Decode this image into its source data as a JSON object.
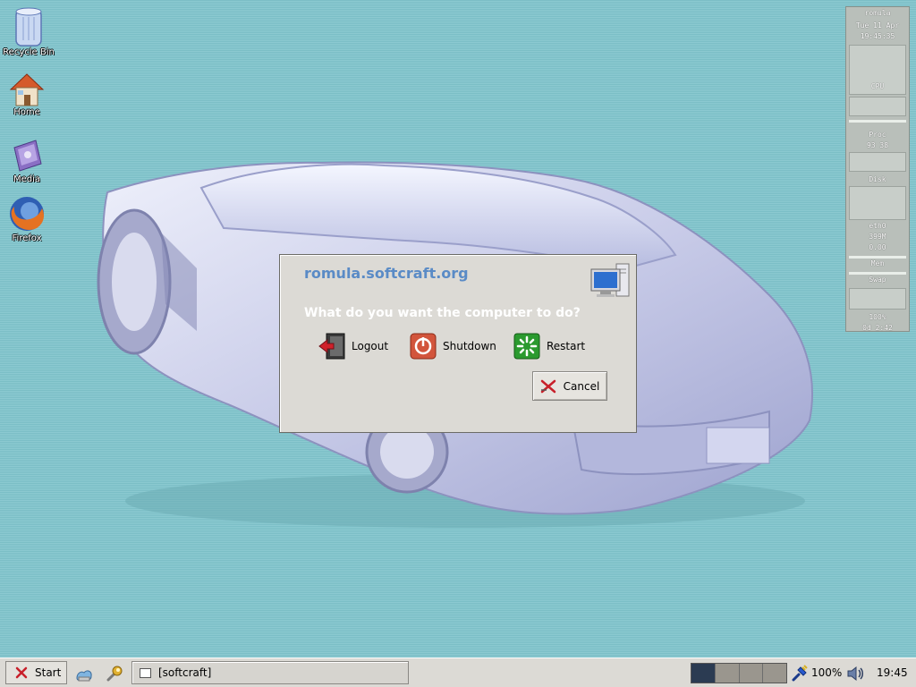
{
  "desktop": {
    "icons": [
      {
        "label": "Recycle Bin"
      },
      {
        "label": "Home"
      },
      {
        "label": "Media"
      },
      {
        "label": "Firefox"
      }
    ]
  },
  "gkrellm": {
    "hostname": "romula",
    "date": "Tue 11 Apr",
    "time": "19:45:35",
    "cpu_label": "CPU",
    "proc_label": "Proc",
    "proc_value": "93 38",
    "disk_label": "Disk",
    "net_label": "eth0",
    "mem_value": "399M",
    "swap_value": "0.00",
    "mem_label": "Mem",
    "swap_label": "Swap",
    "battery_value": "100%",
    "uptime": "0d 2:42"
  },
  "dialog": {
    "hostname": "romula.softcraft.org",
    "question": "What do you want the computer to do?",
    "logout_label": "Logout",
    "shutdown_label": "Shutdown",
    "restart_label": "Restart",
    "cancel_label": "Cancel"
  },
  "taskbar": {
    "start_label": "Start",
    "task_label": "[softcraft]",
    "pager_desks": 4,
    "pager_active": 1,
    "battery_percent": "100%",
    "clock": "19:45"
  },
  "colors": {
    "desktop_bg": "#7fc4cc",
    "dialog_bg": "#dcdad5",
    "hostname_blue": "#5a8bc6",
    "pager_active": "#2b3b52"
  }
}
